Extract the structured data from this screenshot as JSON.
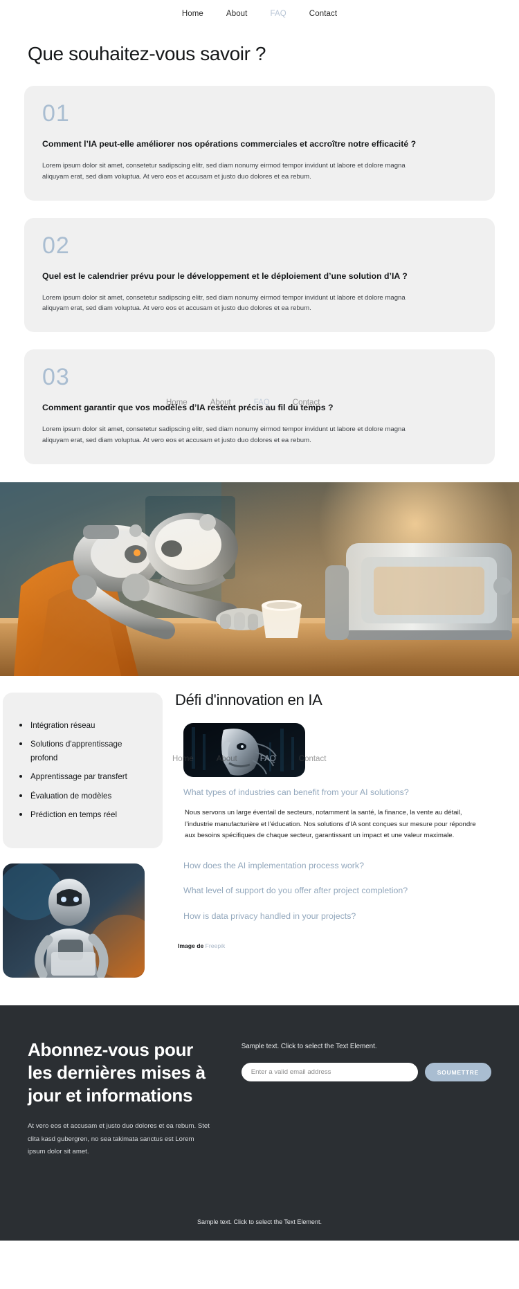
{
  "nav": {
    "items": [
      {
        "label": "Home",
        "active": false
      },
      {
        "label": "About",
        "active": false
      },
      {
        "label": "FAQ",
        "active": true
      },
      {
        "label": "Contact",
        "active": false
      }
    ]
  },
  "faq": {
    "title": "Que souhaitez-vous savoir ?",
    "cards": [
      {
        "number": "01",
        "question": "Comment l’IA peut-elle améliorer nos opérations commerciales et accroître notre efficacité ?",
        "answer": "Lorem ipsum dolor sit amet, consetetur sadipscing elitr, sed diam nonumy eirmod tempor invidunt ut labore et dolore magna aliquyam erat, sed diam voluptua. At vero eos et accusam et justo duo dolores et ea rebum."
      },
      {
        "number": "02",
        "question": "Quel est le calendrier prévu pour le développement et le déploiement d’une solution d’IA ?",
        "answer": "Lorem ipsum dolor sit amet, consetetur sadipscing elitr, sed diam nonumy eirmod tempor invidunt ut labore et dolore magna aliquyam erat, sed diam voluptua. At vero eos et accusam et justo duo dolores et ea rebum."
      },
      {
        "number": "03",
        "question": "Comment garantir que vos modèles d’IA restent précis au fil du temps ?",
        "answer": "Lorem ipsum dolor sit amet, consetetur sadipscing elitr, sed diam nonumy eirmod tempor invidunt ut labore et dolore magna aliquyam erat, sed diam voluptua. At vero eos et accusam et justo duo dolores et ea rebum."
      }
    ]
  },
  "innovation": {
    "title": "Défi d'innovation en IA",
    "bullets": [
      "Intégration réseau",
      "Solutions d'apprentissage profond",
      "Apprentissage par transfert",
      "Évaluation de modèles",
      "Prédiction en temps réel"
    ],
    "accordion": [
      {
        "question": "What types of industries can benefit from your AI solutions?",
        "answer": "Nous servons un large éventail de secteurs, notamment la santé, la finance, la vente au détail, l’industrie manufacturière et l’éducation. Nos solutions d’IA sont conçues sur mesure pour répondre aux besoins spécifiques de chaque secteur, garantissant un impact et une valeur maximale.",
        "open": true
      },
      {
        "question": "How does the AI implementation process work?",
        "answer": "",
        "open": false
      },
      {
        "question": "What level of support do you offer after project completion?",
        "answer": "",
        "open": false
      },
      {
        "question": "How is data privacy handled in your projects?",
        "answer": "",
        "open": false
      }
    ],
    "credit_label": "Image de",
    "credit_link": "Freepik"
  },
  "footer": {
    "title": "Abonnez-vous pour les dernières mises à jour et informations",
    "subtitle": "At vero eos et accusam et justo duo dolores et ea rebum. Stet clita kasd gubergren, no sea takimata sanctus est Lorem ipsum dolor sit amet.",
    "form_label": "Sample text. Click to select the Text Element.",
    "email_placeholder": "Enter a valid email address",
    "email_value": "",
    "submit_label": "SOUMETTRE",
    "bottom_text": "Sample text. Click to select the Text Element."
  },
  "colors": {
    "accent_blue": "#a9bdd1",
    "card_bg": "#f0f0f0",
    "footer_bg": "#2b2f33",
    "text_dark": "#16181a",
    "muted_blue": "#93a8bd"
  }
}
